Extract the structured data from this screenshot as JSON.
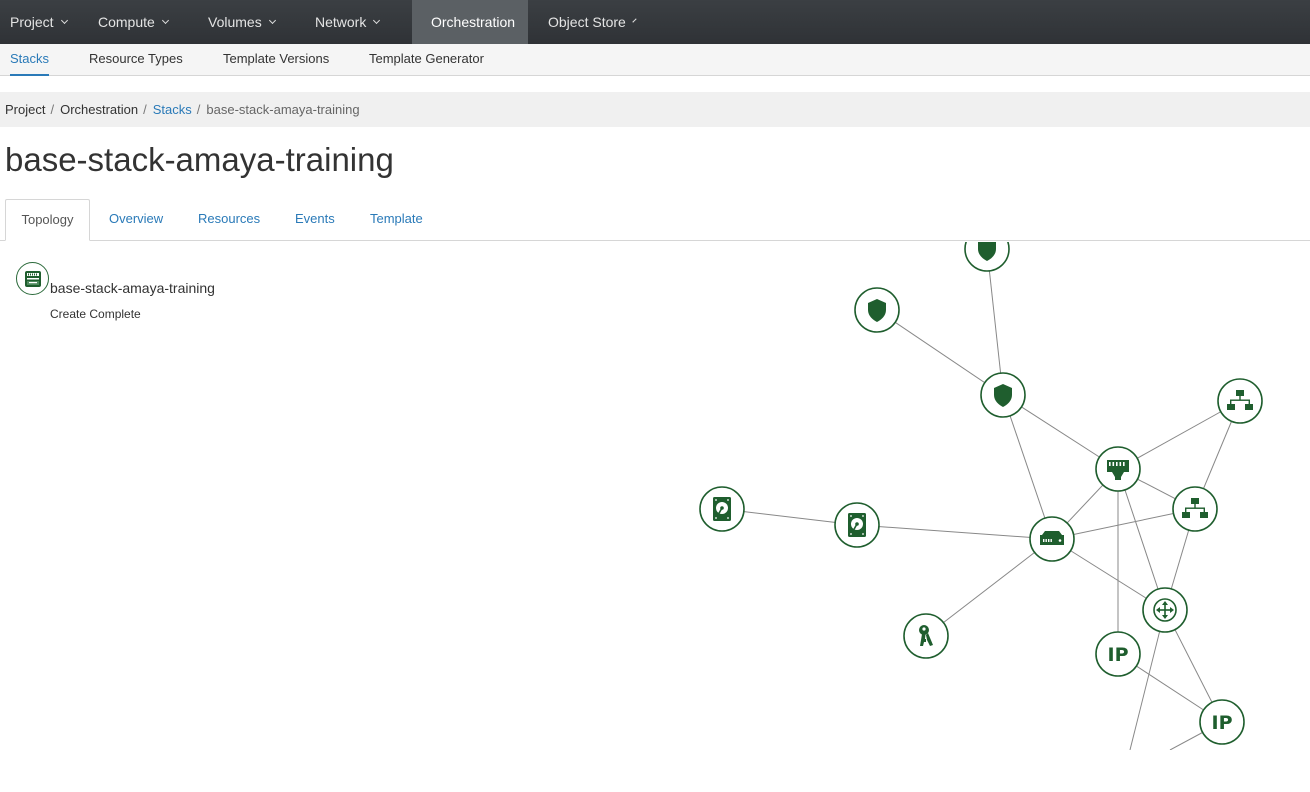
{
  "topnav": {
    "items": [
      {
        "label": "Project",
        "dropdown": true,
        "active": false
      },
      {
        "label": "Compute",
        "dropdown": true,
        "active": false
      },
      {
        "label": "Volumes",
        "dropdown": true,
        "active": false
      },
      {
        "label": "Network",
        "dropdown": true,
        "active": false
      },
      {
        "label": "Orchestration",
        "dropdown": false,
        "active": true
      },
      {
        "label": "Object Store",
        "dropdown": true,
        "active": false
      }
    ]
  },
  "subnav": {
    "items": [
      {
        "label": "Stacks",
        "active": true
      },
      {
        "label": "Resource Types",
        "active": false
      },
      {
        "label": "Template Versions",
        "active": false
      },
      {
        "label": "Template Generator",
        "active": false
      }
    ]
  },
  "breadcrumb": {
    "items": [
      "Project",
      "Orchestration",
      "Stacks",
      "base-stack-amaya-training"
    ],
    "separator": "/"
  },
  "page": {
    "title": "base-stack-amaya-training"
  },
  "tabs": {
    "items": [
      "Topology",
      "Overview",
      "Resources",
      "Events",
      "Template"
    ],
    "active": "Topology"
  },
  "stack": {
    "name": "base-stack-amaya-training",
    "status": "Create Complete"
  },
  "topology": {
    "accent_color": "#1f5e2e",
    "edge_color": "#888888",
    "node_types": [
      "security-group-icon",
      "network-icon",
      "port-icon",
      "server-icon",
      "volume-icon",
      "router-icon",
      "keypair-icon",
      "floating-ip-icon"
    ],
    "ip_label": "IP"
  },
  "colors": {
    "nav_bg": "#34383c",
    "nav_active": "#5b6064",
    "link": "#2a7ab8"
  }
}
